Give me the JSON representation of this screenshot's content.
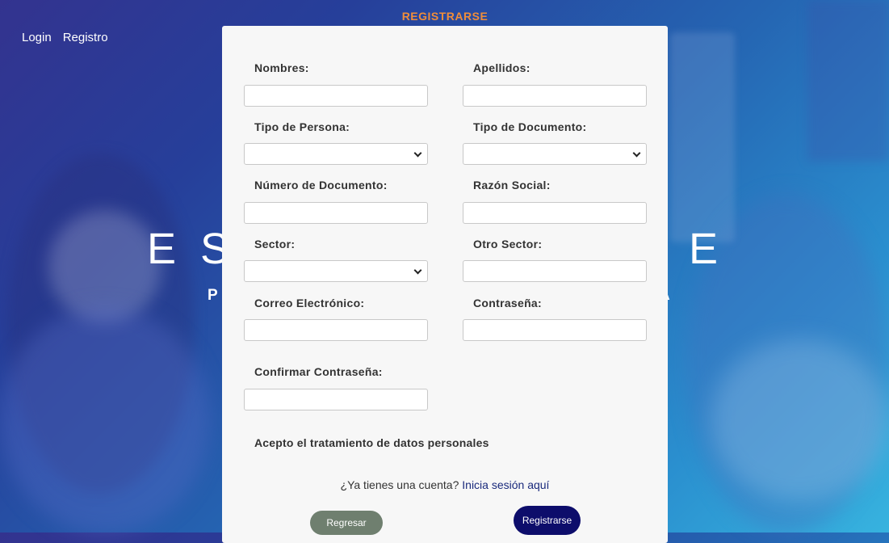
{
  "nav": {
    "login": "Login",
    "register": "Registro"
  },
  "hero": {
    "title_left_letters": [
      "E",
      "S"
    ],
    "title_right_letters": [
      "E"
    ],
    "subtitle_left": "P",
    "subtitle_right": "A"
  },
  "form": {
    "heading": "REGISTRARSE",
    "fields": {
      "nombres": {
        "label": "Nombres:",
        "value": ""
      },
      "apellidos": {
        "label": "Apellidos:",
        "value": ""
      },
      "tipo_persona": {
        "label": "Tipo de Persona:",
        "selected": ""
      },
      "tipo_documento": {
        "label": "Tipo de Documento:",
        "selected": ""
      },
      "numero_documento": {
        "label": "Número de Documento:",
        "value": ""
      },
      "razon_social": {
        "label": "Razón Social:",
        "value": ""
      },
      "sector": {
        "label": "Sector:",
        "selected": ""
      },
      "otro_sector": {
        "label": "Otro Sector:",
        "value": ""
      },
      "correo": {
        "label": "Correo Electrónico:",
        "value": ""
      },
      "contrasena": {
        "label": "Contraseña:",
        "value": ""
      },
      "confirmar": {
        "label": "Confirmar Contraseña:",
        "value": ""
      }
    },
    "consent": "Acepto el tratamiento de datos personales",
    "account_prompt": "¿Ya tienes una cuenta?",
    "account_link": "Inicia sesión aquí",
    "back_button": "Regresar",
    "register_button": "Registrarse"
  },
  "colors": {
    "heading": "#ef8d3a",
    "register_button": "#0d0d6b",
    "back_button": "#6f7f6f",
    "link": "#1a2a7c"
  }
}
